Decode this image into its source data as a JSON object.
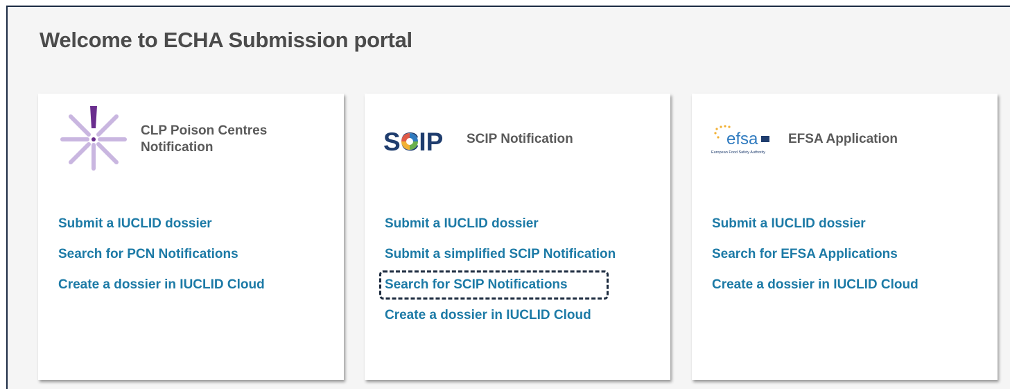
{
  "page": {
    "title": "Welcome to ECHA Submission portal"
  },
  "cards": [
    {
      "title": "CLP Poison Centres Notification",
      "links": [
        "Submit a IUCLID dossier",
        "Search for PCN Notifications",
        "Create a dossier in IUCLID Cloud"
      ]
    },
    {
      "title": "SCIP Notification",
      "logo_text": "SCIP",
      "links": [
        "Submit a IUCLID dossier",
        "Submit a simplified SCIP Notification",
        "Search for SCIP Notifications",
        "Create a dossier in IUCLID Cloud"
      ]
    },
    {
      "title": "EFSA Application",
      "logo_text": "efsa",
      "logo_subtext": "European Food Safety Authority",
      "links": [
        "Submit a IUCLID dossier",
        "Search for EFSA Applications",
        "Create a dossier in IUCLID Cloud"
      ]
    }
  ],
  "colors": {
    "link": "#1c7aa6",
    "title": "#4b4b4b",
    "frame_border": "#1c2c44",
    "pcn_logo": "#c9b6e0",
    "scip_logo": "#1f3d6e",
    "efsa_logo": "#2e7abf"
  },
  "icons": [
    "pcn-logo-icon",
    "scip-logo-icon",
    "efsa-logo-icon"
  ]
}
